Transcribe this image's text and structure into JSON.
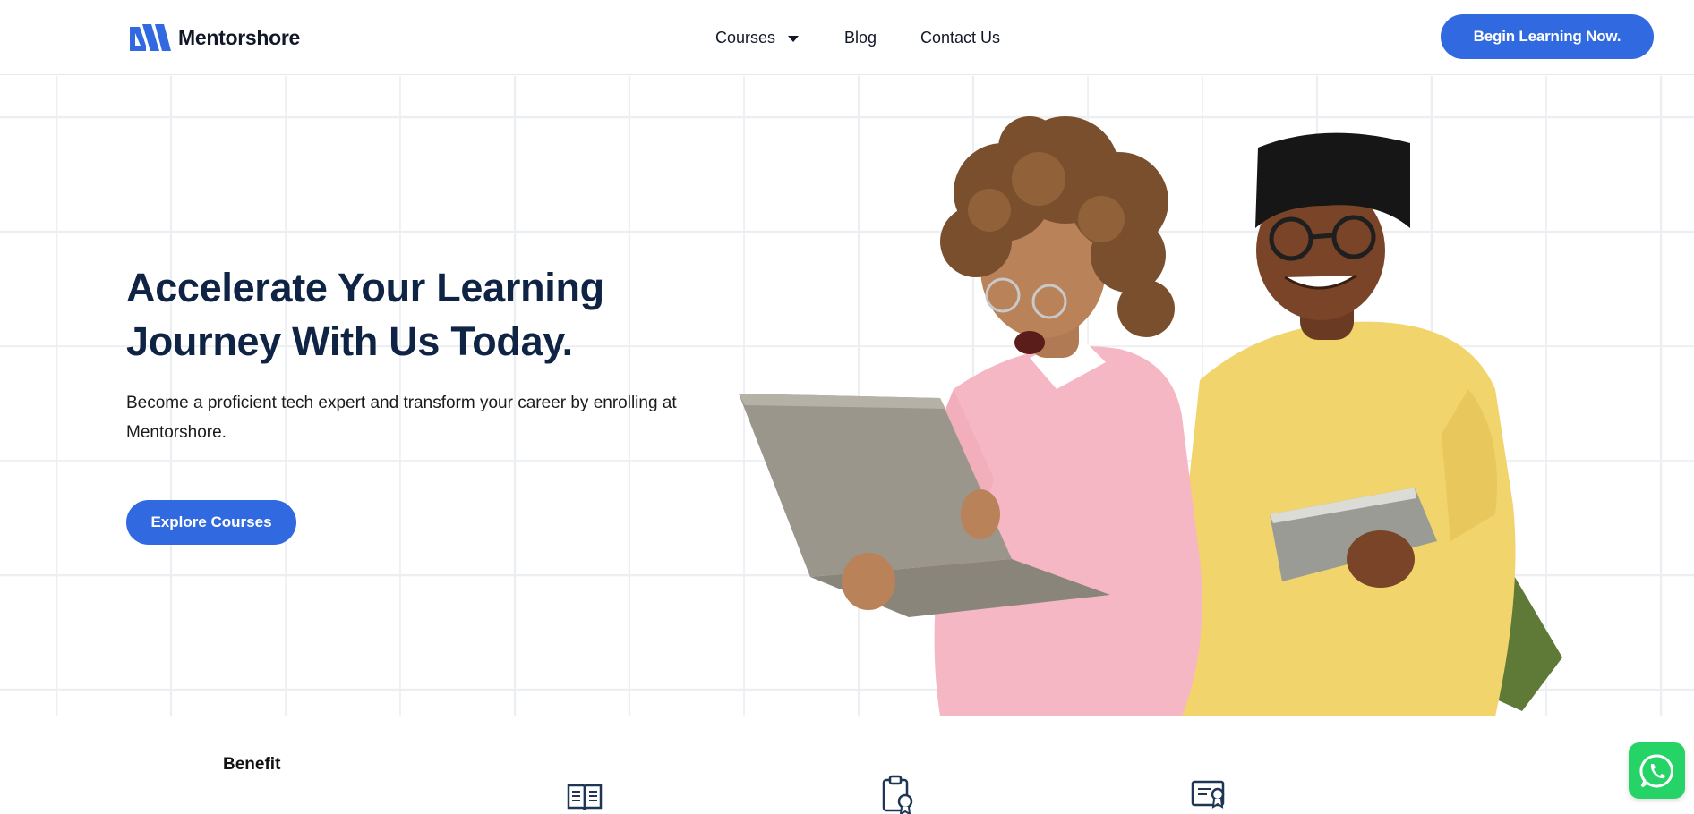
{
  "brand": {
    "name": "Mentorshore",
    "accent_color": "#3169e0",
    "heading_color": "#0f2445"
  },
  "nav": {
    "items": [
      {
        "label": "Courses",
        "has_dropdown": true
      },
      {
        "label": "Blog"
      },
      {
        "label": "Contact Us"
      }
    ],
    "cta_label": "Begin Learning Now."
  },
  "hero": {
    "title_line1": "Accelerate Your Learning",
    "title_line2": "Journey With Us Today.",
    "subtitle": "Become a proficient tech expert and transform your career by enrolling at Mentorshore.",
    "cta_label": "Explore Courses"
  },
  "benefits": {
    "label": "Benefit",
    "icons": [
      "book-icon",
      "clipboard-badge-icon",
      "certificate-icon"
    ]
  },
  "floating": {
    "whatsapp_icon": "whatsapp-icon",
    "whatsapp_color": "#25d366"
  }
}
